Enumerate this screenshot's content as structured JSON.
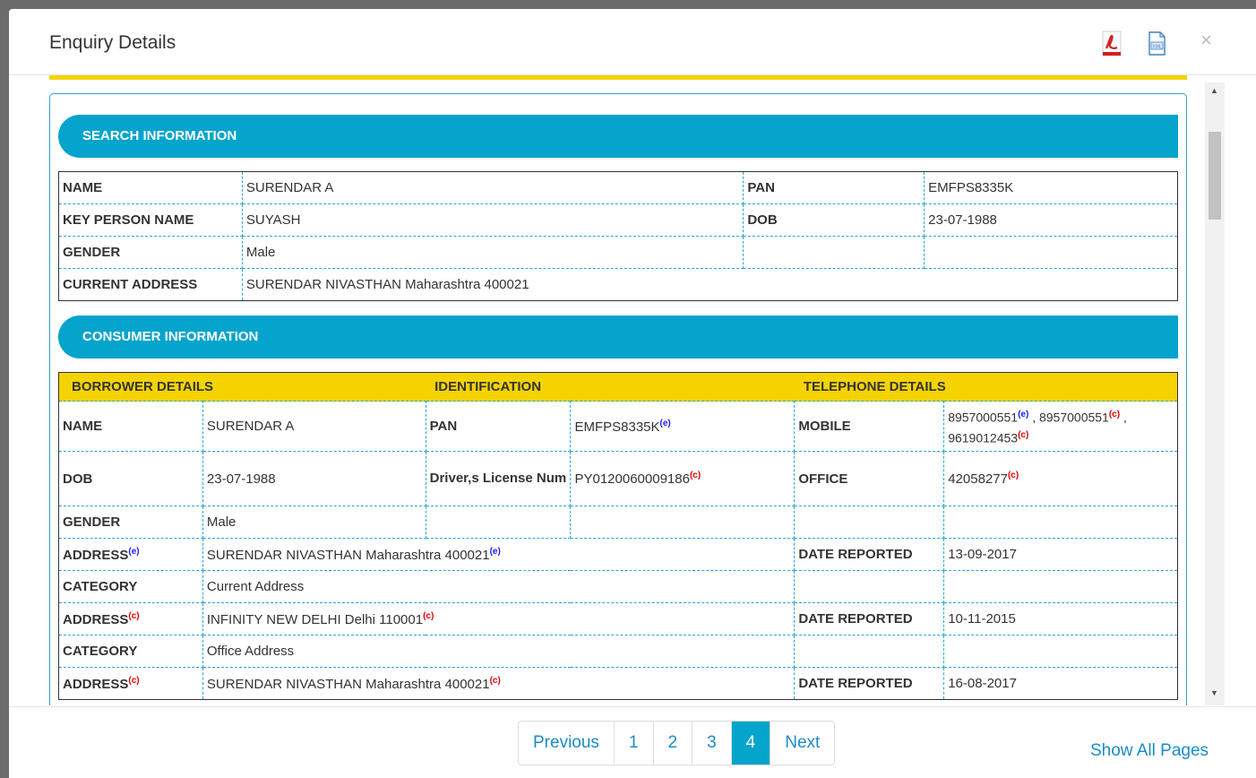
{
  "modal": {
    "title": "Enquiry Details",
    "close_label": "×"
  },
  "search_section": {
    "title": "SEARCH INFORMATION",
    "rows": [
      {
        "l1": "NAME",
        "v1": "SURENDAR A",
        "l2": "PAN",
        "v2": "EMFPS8335K"
      },
      {
        "l1": "KEY PERSON NAME",
        "v1": "SUYASH",
        "l2": "DOB",
        "v2": "23-07-1988"
      },
      {
        "l1": "GENDER",
        "v1": "Male",
        "l2": "",
        "v2": ""
      },
      {
        "l1": "CURRENT ADDRESS",
        "v1": "SURENDAR NIVASTHAN Maharashtra 400021"
      }
    ]
  },
  "consumer_section": {
    "title": "CONSUMER INFORMATION",
    "headers": [
      "BORROWER DETAILS",
      "IDENTIFICATION",
      "TELEPHONE DETAILS"
    ],
    "name_label": "NAME",
    "name_value": "SURENDAR A",
    "pan_label": "PAN",
    "pan_value": "EMFPS8335K",
    "mobile_label": "MOBILE",
    "mobile_1": "8957000551",
    "mobile_2": " , 8957000551",
    "mobile_sep": " ,",
    "mobile_3": "9619012453",
    "dob_label": "DOB",
    "dob_value": "23-07-1988",
    "license_label": "Driver,s License Num",
    "license_value": "PY0120060009186",
    "office_label": "OFFICE",
    "office_value": "42058277",
    "gender_label": "GENDER",
    "gender_value": "Male",
    "addr1_label": "ADDRESS",
    "addr1_value": "SURENDAR NIVASTHAN Maharashtra 400021",
    "date1_label": "DATE REPORTED",
    "date1_value": "13-09-2017",
    "cat1_label": "CATEGORY",
    "cat1_value": "Current Address",
    "addr2_label": "ADDRESS",
    "addr2_value": "INFINITY NEW DELHI Delhi 110001",
    "date2_label": "DATE REPORTED",
    "date2_value": "10-11-2015",
    "cat2_label": "CATEGORY",
    "cat2_value": "Office Address",
    "addr3_label": "ADDRESS",
    "addr3_value": "SURENDAR NIVASTHAN Maharashtra 400021",
    "date3_label": "DATE REPORTED",
    "date3_value": "16-08-2017",
    "sup_e": "(e)",
    "sup_c": "(c)"
  },
  "pagination": {
    "previous": "Previous",
    "pages": [
      "1",
      "2",
      "3",
      "4"
    ],
    "active_page": "4",
    "next": "Next",
    "show_all": "Show All Pages"
  },
  "icons": [
    "pdf-icon",
    "xml-file-icon",
    "close-icon",
    "scroll-up-arrow-icon",
    "scroll-down-arrow-icon"
  ],
  "colors": {
    "accent": "#05a4cc",
    "highlight": "#f5d300",
    "link": "#1a8cc8"
  }
}
